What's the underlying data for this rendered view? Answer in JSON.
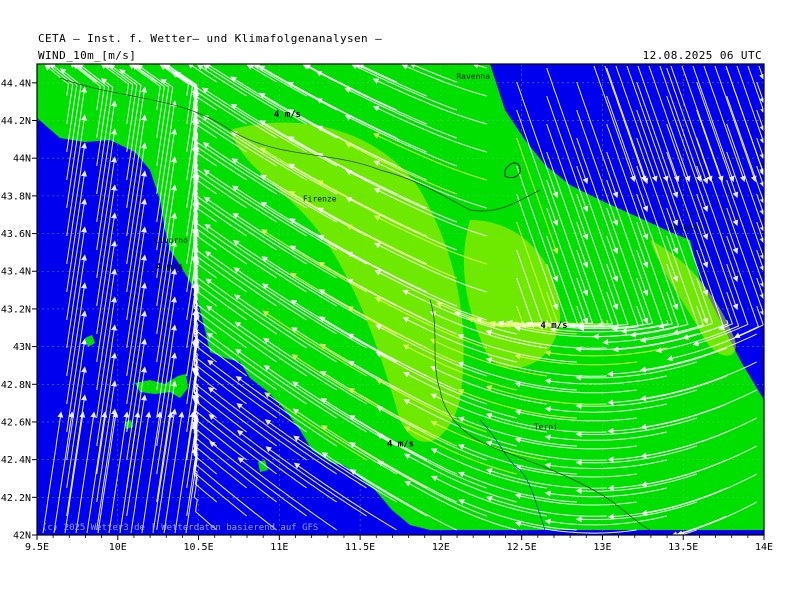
{
  "header": {
    "title": "CETA – Inst. f. Wetter– und Klimafolgenanalysen –",
    "field": "WIND_10m_[m/s]",
    "datetime": "12.08.2025 06 UTC"
  },
  "map": {
    "lon_range": [
      9.5,
      14.0
    ],
    "lat_range": [
      42.0,
      44.5
    ],
    "x_ticks": [
      "9.5E",
      "10E",
      "10.5E",
      "11E",
      "11.5E",
      "12E",
      "12.5E",
      "13E",
      "13.5E",
      "14E"
    ],
    "x_tick_values": [
      9.5,
      10.0,
      10.5,
      11.0,
      11.5,
      12.0,
      12.5,
      13.0,
      13.5,
      14.0
    ],
    "y_ticks": [
      "42N",
      "42.2N",
      "42.4N",
      "42.6N",
      "42.8N",
      "43N",
      "43.2N",
      "43.4N",
      "43.6N",
      "43.8N",
      "44N",
      "44.2N",
      "44.4N"
    ],
    "y_tick_values": [
      42.0,
      42.2,
      42.4,
      42.6,
      42.8,
      43.0,
      43.2,
      43.4,
      43.6,
      43.8,
      44.0,
      44.2,
      44.4
    ],
    "cities": [
      {
        "name": "Ravenna",
        "lon": 12.2,
        "lat": 44.42
      },
      {
        "name": "Firenze",
        "lon": 11.25,
        "lat": 43.77
      },
      {
        "name": "Livorno",
        "lon": 10.33,
        "lat": 43.55
      },
      {
        "name": "Ancona",
        "lon": 13.5,
        "lat": 43.62
      },
      {
        "name": "Terni",
        "lon": 12.65,
        "lat": 42.56
      }
    ],
    "wind_labels": [
      {
        "text": "4 m/s",
        "lon": 11.05,
        "lat": 44.22
      },
      {
        "text": "4 m/s",
        "lon": 10.32,
        "lat": 43.41
      },
      {
        "text": "4 m/s",
        "lon": 12.7,
        "lat": 43.1
      },
      {
        "text": "4 m/s",
        "lon": 11.75,
        "lat": 42.47
      }
    ],
    "footer_text": "(c) 2025 Wetter3.de | Wetterdaten basierend auf GFS",
    "colors": {
      "sea": "#0000ee",
      "land": "#00e000",
      "yellow": "#c8f000",
      "streamline": "#ffffff",
      "grid": "#7fbf7f"
    }
  }
}
